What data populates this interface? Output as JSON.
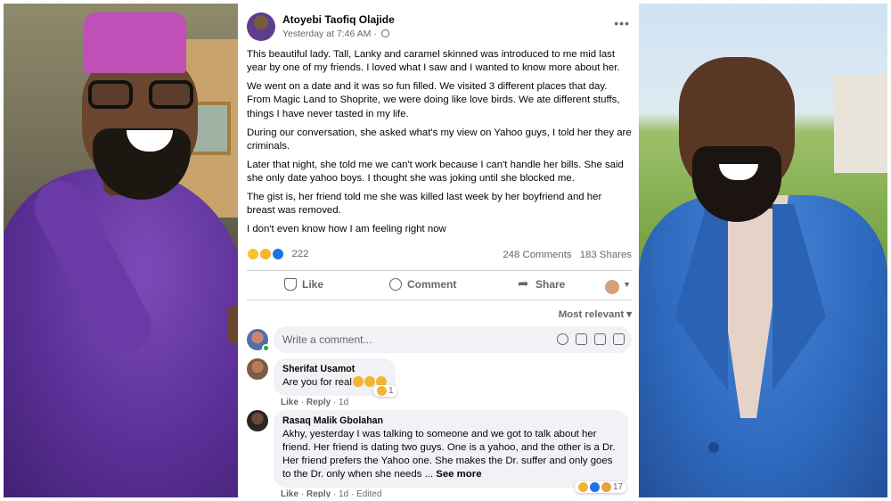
{
  "post": {
    "author": "Atoyebi Taofiq Olajide",
    "timestamp": "Yesterday at 7:46 AM",
    "separator": "·",
    "paragraphs": [
      "This beautiful lady. Tall, Lanky and caramel skinned was introduced to me mid last year by one of my friends. I loved what I saw and I wanted to know more about her.",
      "We went on a date and it was so fun filled. We visited 3 different places that day. From Magic Land to Shoprite, we were doing like love birds. We ate different stuffs, things I have never tasted in my life.",
      "During our conversation, she asked what's my view on Yahoo guys, I told her they are criminals.",
      "Later that night, she told me we can't work because I can't handle her bills. She said she only date yahoo boys. I thought she was joking until she blocked me.",
      "The gist is, her friend told me she was killed last week by her boyfriend and her breast was removed.",
      "I don't even know how I am feeling right now"
    ],
    "reaction_count": "222",
    "comments_count": "248 Comments",
    "shares_count": "183 Shares"
  },
  "actions": {
    "like": "Like",
    "comment": "Comment",
    "share": "Share"
  },
  "sort": {
    "label": "Most relevant ▾"
  },
  "composer": {
    "placeholder": "Write a comment..."
  },
  "comments": [
    {
      "name": "Sherifat Usamot",
      "text": "Are you for real",
      "like": "Like",
      "reply": "Reply",
      "meta": "· 1d",
      "reaction_count": "1"
    },
    {
      "name": "Rasaq Malik Gbolahan",
      "text": "Akhy, yesterday I was talking to someone and we got to talk about her friend. Her friend is dating two guys. One is a yahoo, and the other is a Dr. Her friend prefers the Yahoo one. She makes the Dr. suffer and only goes to the Dr. only when she needs ...",
      "see_more": "See more",
      "like": "Like",
      "reply": "Reply",
      "meta": "· 1d · Edited",
      "reaction_count": "17"
    }
  ],
  "icons": {
    "more": "more-icon",
    "globe": "globe-icon",
    "like": "thumb-icon",
    "comment": "comment-bubble-icon",
    "share": "share-arrow-icon",
    "emoji": "emoji-icon",
    "camera": "camera-icon",
    "gif": "gif-icon",
    "sticker": "sticker-icon"
  },
  "colors": {
    "text": "#050505",
    "secondary": "#65676b",
    "bubble": "#f0f2f5",
    "like_blue": "#1b74e4",
    "online_green": "#31a24c"
  }
}
